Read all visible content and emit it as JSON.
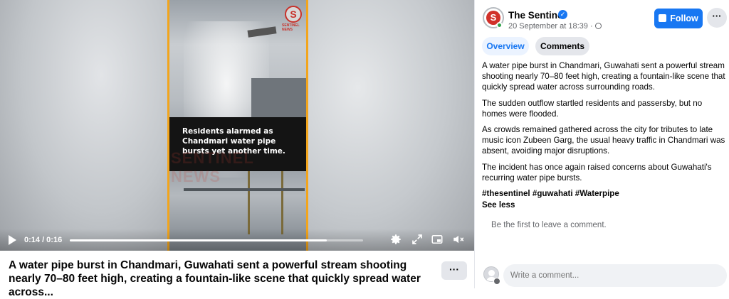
{
  "video": {
    "caption": "Residents alarmed as Chandmari water pipe bursts yet another time.",
    "watermark": "SENTINEL NEWS",
    "logo_letter": "S",
    "logo_sub": "SENTINEL NEWS",
    "time": "0:14 / 0:16",
    "progress_fraction": 0.875,
    "icons": [
      "play-icon",
      "settings-icon",
      "fullscreen-icon",
      "picture-in-picture-icon",
      "mute-icon"
    ]
  },
  "title_row": {
    "title": "A water pipe burst in Chandmari, Guwahati sent a powerful stream shooting nearly 70–80 feet high, creating a fountain-like scene that quickly spread water across...",
    "more_label": "···"
  },
  "post": {
    "page_name": "The Sentinel",
    "verified_mark": "✓",
    "avatar_letter": "S",
    "timestamp": "20 September at 18:39 · ",
    "audience_icon": "globe-icon",
    "follow_label": "Follow",
    "more_label": "···",
    "tabs": [
      {
        "label": "Overview",
        "active": true
      },
      {
        "label": "Comments",
        "active": false
      }
    ],
    "paragraphs": [
      "A water pipe burst in Chandmari, Guwahati sent a powerful stream shooting nearly 70–80 feet high, creating a fountain-like scene that quickly spread water across surrounding roads.",
      "The sudden outflow startled residents and passersby, but no homes were flooded.",
      "As crowds remained gathered across the city for tributes to late music icon Zubeen Garg, the usual heavy traffic in Chandmari was absent, avoiding major disruptions.",
      "The incident has once again raised concerns about Guwahati's recurring water pipe bursts."
    ],
    "hashtags": "#thesentinel #guwahati #Waterpipe",
    "see_less": "See less",
    "empty_comments": "Be the first to leave a comment.",
    "comment_placeholder": "Write a comment..."
  },
  "colors": {
    "accent": "#1877f2",
    "reel_border": "#f2a51d",
    "online": "#31a24c",
    "muted_text": "#65676b"
  }
}
